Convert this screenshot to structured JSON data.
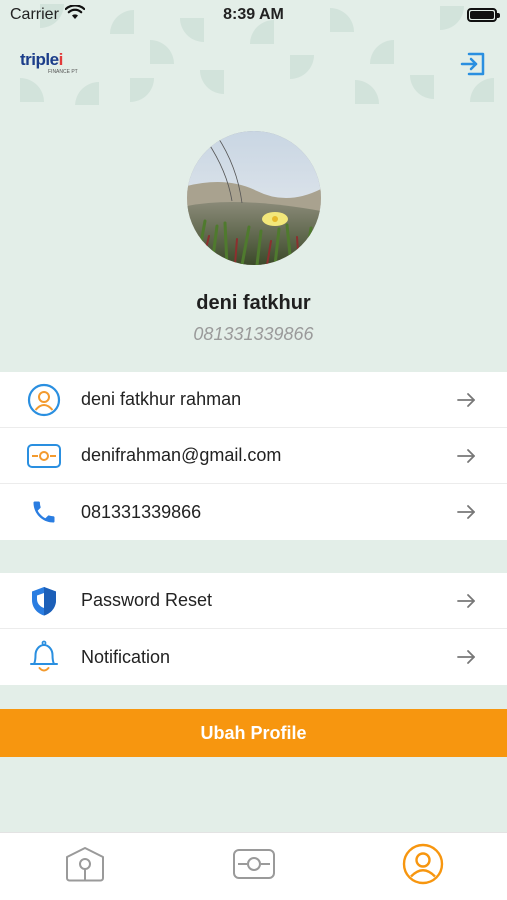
{
  "status_bar": {
    "carrier": "Carrier",
    "time": "8:39 AM",
    "icons": [
      "wifi-icon",
      "battery-icon"
    ]
  },
  "header": {
    "logo_text_main": "triple",
    "logo_text_accent": "i",
    "logo_subtext": "FINANCE PT",
    "logout_icon": "logout-icon"
  },
  "profile": {
    "name": "deni fatkhur",
    "phone": "081331339866"
  },
  "account_list": [
    {
      "icon": "person-icon",
      "label": "deni fatkhur rahman"
    },
    {
      "icon": "id-card-icon",
      "label": "denifrahman@gmail.com"
    },
    {
      "icon": "phone-icon",
      "label": "081331339866"
    }
  ],
  "settings_list": [
    {
      "icon": "shield-icon",
      "label": "Password Reset"
    },
    {
      "icon": "bell-icon",
      "label": "Notification"
    }
  ],
  "cta": {
    "label": "Ubah Profile"
  },
  "bottom_nav": [
    {
      "icon": "home-icon",
      "active": false
    },
    {
      "icon": "card-icon",
      "active": false
    },
    {
      "icon": "profile-icon",
      "active": true
    }
  ],
  "colors": {
    "accent_orange": "#f7960f",
    "accent_blue": "#2a7de1",
    "background": "#e3eee8"
  }
}
